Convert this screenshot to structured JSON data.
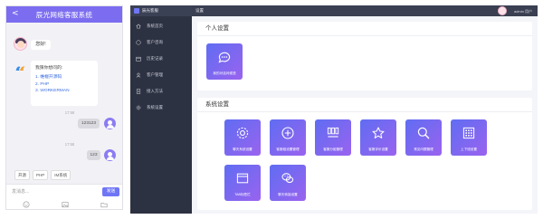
{
  "chat": {
    "title": "辰光网络客服系统",
    "back_icon": "chevron-left-icon",
    "greeting": "您好!",
    "question_prompt": "我猜你想问的:",
    "options": [
      "1. 帷幄开源码",
      "2. PHP",
      "3. WORKERMAN"
    ],
    "timestamp_1": "17:58",
    "message_1": "123123",
    "timestamp_2": "17:58",
    "message_2": "123",
    "quick_replies": [
      "开源",
      "PHP",
      "IM系统"
    ],
    "input_placeholder": "发消息...",
    "send_label": "发送",
    "tools": [
      "emoji-icon",
      "image-icon",
      "folder-icon"
    ]
  },
  "admin": {
    "brand": "辰光客服",
    "nav": [
      {
        "label": "系统首页",
        "icon": "home-icon"
      },
      {
        "label": "客户咨询",
        "icon": "chat-icon"
      },
      {
        "label": "历史记录",
        "icon": "calendar-icon"
      },
      {
        "label": "客户管理",
        "icon": "user-icon"
      },
      {
        "label": "接入方法",
        "icon": "document-icon"
      },
      {
        "label": "系统设置",
        "icon": "gear-icon"
      }
    ],
    "breadcrumb": "设置",
    "user_name": "admin 用户",
    "personal_section": "个人设置",
    "personal_tiles": [
      {
        "label": "我的对话问候语",
        "icon": "chat-dots-icon"
      }
    ],
    "system_section": "系统设置",
    "system_tiles": [
      {
        "label": "聊天系统设置",
        "icon": "gear-icon"
      },
      {
        "label": "客服组设置管理",
        "icon": "plus-circle-icon"
      },
      {
        "label": "客服分组管理",
        "icon": "grid-bars-icon"
      },
      {
        "label": "客服评价设置",
        "icon": "star-icon"
      },
      {
        "label": "常见问题管理",
        "icon": "magnifier-icon"
      },
      {
        "label": "上下班设置",
        "icon": "calendar-grid-icon"
      },
      {
        "label": "TAB标签栏",
        "icon": "window-icon"
      },
      {
        "label": "聊天转接设置",
        "icon": "wechat-icon"
      }
    ],
    "accent_color": "#6f76f5",
    "sidebar_color": "#2d3242"
  }
}
